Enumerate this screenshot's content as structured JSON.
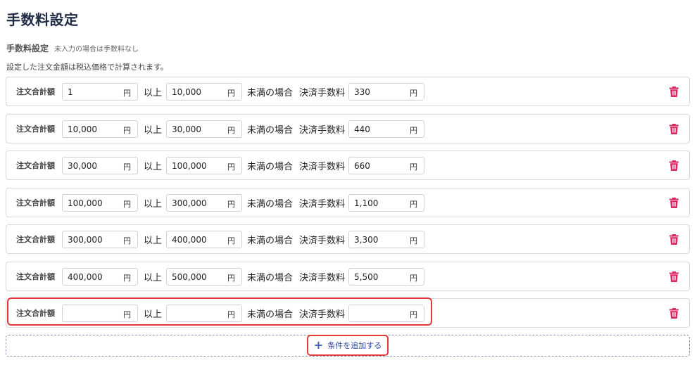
{
  "page": {
    "title": "手数料設定"
  },
  "section": {
    "label": "手数料設定",
    "note": "未入力の場合は手数料なし",
    "description": "設定した注文金額は税込価格で計算されます。"
  },
  "row_labels": {
    "order_total": "注文合計額",
    "or_more": "以上",
    "less_than": "未満の場合",
    "fee": "決済手数料",
    "unit": "円"
  },
  "rows": [
    {
      "from": "1",
      "to": "10,000",
      "fee": "330"
    },
    {
      "from": "10,000",
      "to": "30,000",
      "fee": "440"
    },
    {
      "from": "30,000",
      "to": "100,000",
      "fee": "660"
    },
    {
      "from": "100,000",
      "to": "300,000",
      "fee": "1,100"
    },
    {
      "from": "300,000",
      "to": "400,000",
      "fee": "3,300"
    },
    {
      "from": "400,000",
      "to": "500,000",
      "fee": "5,500"
    },
    {
      "from": "",
      "to": "",
      "fee": ""
    }
  ],
  "add_button": {
    "label": "条件を追加する",
    "icon": "plus-icon"
  },
  "icons": {
    "delete": "trash-icon"
  },
  "colors": {
    "title": "#1f2a44",
    "trash": "#e0245e",
    "highlight": "#e53935",
    "add_accent": "#3a5bb5"
  }
}
